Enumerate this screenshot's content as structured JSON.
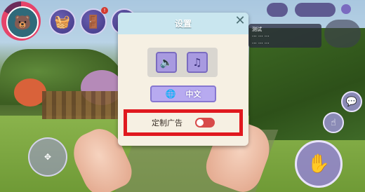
{
  "settings_dialog": {
    "title": "设置",
    "close_glyph": "✕",
    "language_button_label": "中文",
    "custom_ads_label": "定制广告",
    "custom_ads_enabled": false,
    "highlight_color": "#e0191f"
  },
  "chat_panel": {
    "lines": [
      "测试",
      "··· ··· ···",
      "··· ··· ···"
    ]
  },
  "hud": {
    "wave_glyph": "✋",
    "notification_badge": "!"
  },
  "colors": {
    "header": "#c9e6ef",
    "dialog_bg": "#f6f0e3",
    "button_purple": "#a89ae0",
    "toggle_off": "#d84a4a"
  }
}
